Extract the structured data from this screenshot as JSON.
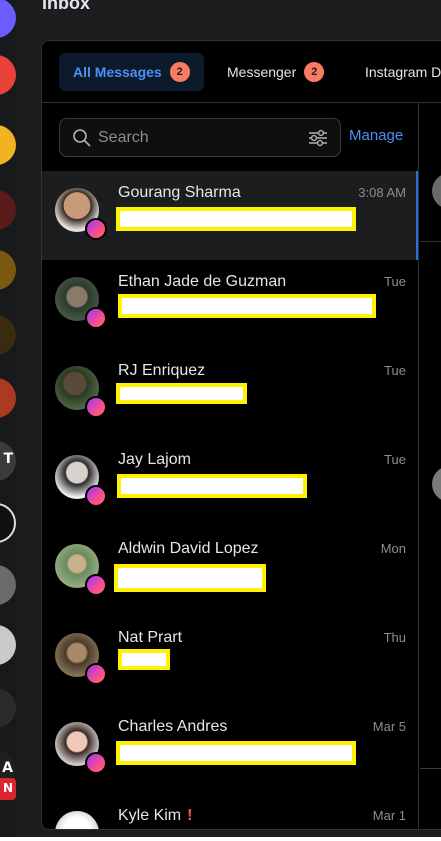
{
  "page_title": "Inbox",
  "tabs": [
    {
      "label": "All Messages",
      "badge": "2"
    },
    {
      "label": "Messenger",
      "badge": "2"
    },
    {
      "label": "Instagram D"
    }
  ],
  "search": {
    "placeholder": "Search",
    "manage_label": "Manage"
  },
  "conversations": [
    {
      "name": "Gourang Sharma",
      "time": "3:08 AM",
      "selected": true
    },
    {
      "name": "Ethan Jade de Guzman",
      "time": "Tue"
    },
    {
      "name": "RJ Enriquez",
      "time": "Tue"
    },
    {
      "name": "Jay Lajom",
      "time": "Tue"
    },
    {
      "name": "Aldwin David Lopez",
      "time": "Mon"
    },
    {
      "name": "Nat Prart",
      "time": "Thu"
    },
    {
      "name": "Charles Andres",
      "time": "Mar 5"
    },
    {
      "name": "Kyle Kim",
      "time": "Mar 1",
      "flag": "!"
    }
  ],
  "rail_labels": [
    "T",
    "A",
    "N"
  ],
  "colors": {
    "accent": "#4c8ff5",
    "badge": "#f77b63",
    "redaction_border": "#fff200",
    "panel_bg": "#000000"
  }
}
